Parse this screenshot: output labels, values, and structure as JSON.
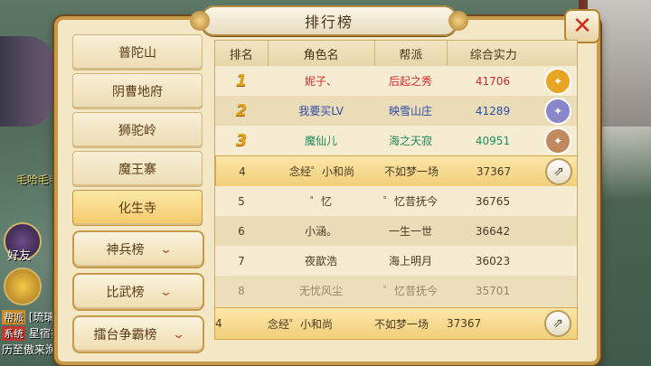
{
  "background": {
    "npc_name": "毛哈毛毛",
    "side_buttons": [
      "好友"
    ],
    "chat": [
      {
        "tag": "帮派",
        "tag_color": "#c98a2a",
        "text": "[琉璃"
      },
      {
        "tag": "系统",
        "tag_color": "#c0392b",
        "text": "星宿扌"
      },
      {
        "tag": "",
        "tag_color": "",
        "text": "历至傲来渔"
      }
    ]
  },
  "panel": {
    "title": "排行榜",
    "close_icon": "close-x-icon"
  },
  "categories": [
    {
      "label": "普陀山",
      "type": "item",
      "active": false
    },
    {
      "label": "阴曹地府",
      "type": "item",
      "active": false
    },
    {
      "label": "狮驼岭",
      "type": "item",
      "active": false
    },
    {
      "label": "魔王寨",
      "type": "item",
      "active": false
    },
    {
      "label": "化生寺",
      "type": "item",
      "active": true
    },
    {
      "label": "神兵榜",
      "type": "group",
      "active": false
    },
    {
      "label": "比武榜",
      "type": "group",
      "active": false
    },
    {
      "label": "擂台争霸榜",
      "type": "group",
      "active": false
    }
  ],
  "table": {
    "headers": [
      "排名",
      "角色名",
      "帮派",
      "综合实力"
    ],
    "rows": [
      {
        "rank": "1",
        "name": "妮子、",
        "guild": "后起之秀",
        "power": "41706",
        "color": "#d12b2b",
        "medal": "gold"
      },
      {
        "rank": "2",
        "name": "我要买LV",
        "guild": "映雪山庄",
        "power": "41289",
        "color": "#2b4aa8",
        "medal": "silver"
      },
      {
        "rank": "3",
        "name": "魔仙儿",
        "guild": "海之天寂",
        "power": "40951",
        "color": "#1f8a5a",
        "medal": "bronze"
      },
      {
        "rank": "4",
        "name": "念经゜小和尚",
        "guild": "不如梦一场",
        "power": "37367",
        "color": "#4a3a22",
        "medal": "",
        "share": true
      },
      {
        "rank": "5",
        "name": "゜忆",
        "guild": "゜忆昔抚今",
        "power": "36765",
        "color": "#4a3a22",
        "medal": ""
      },
      {
        "rank": "6",
        "name": "小涵。",
        "guild": "一生一世",
        "power": "36642",
        "color": "#4a3a22",
        "medal": ""
      },
      {
        "rank": "7",
        "name": "夜歆浩",
        "guild": "海上明月",
        "power": "36023",
        "color": "#4a3a22",
        "medal": ""
      },
      {
        "rank": "8",
        "name": "无忧风尘",
        "guild": "゜忆昔抚今",
        "power": "35701",
        "color": "#4a3a22",
        "medal": ""
      }
    ],
    "my_row": {
      "rank": "4",
      "name": "念经゜小和尚",
      "guild": "不如梦一场",
      "power": "37367"
    }
  },
  "colors": {
    "gold_medal": "#e8a523",
    "silver_medal": "#8a86c9",
    "bronze_medal": "#c08a5e"
  }
}
